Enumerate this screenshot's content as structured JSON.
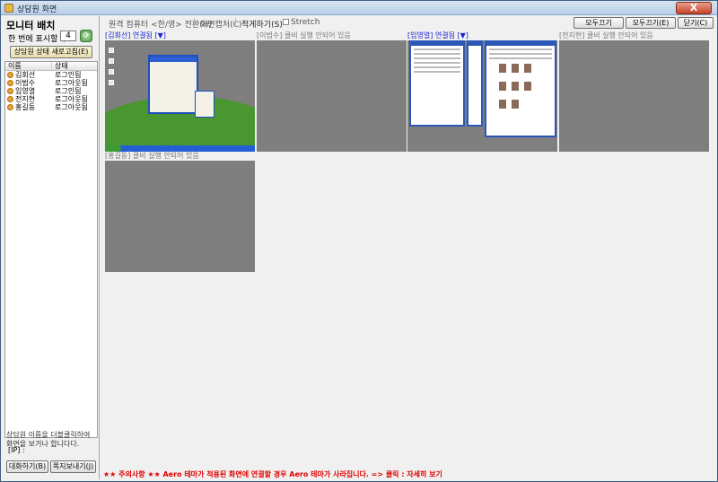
{
  "window": {
    "title": "상담원 화면",
    "close_label": "X"
  },
  "left": {
    "heading": "모니터 배치",
    "count_label": "한 번에 표시할 수",
    "count_value": "4",
    "status_refresh_label": "상담원 상태 새로고침(E)",
    "list_headers": [
      "이름",
      "상태"
    ],
    "agents": [
      {
        "name": "김회선",
        "status": "로그인됨"
      },
      {
        "name": "이범수",
        "status": "로그아웃됨"
      },
      {
        "name": "임영열",
        "status": "로그인됨"
      },
      {
        "name": "전지현",
        "status": "로그아웃됨"
      },
      {
        "name": "홍길동",
        "status": "로그아웃됨"
      }
    ],
    "info_text": "상담원 이름을 더블클릭하여 화면을 보거나 합니다다.",
    "ip_label": "[IP] :",
    "chat_button": "대화하기(B)",
    "message_button": "쪽지보내기(J)"
  },
  "toolbar": {
    "remote_control": "원격 컴퓨터 <한/영> 전환(H)",
    "capture": "화면캡처(C)",
    "arrange": "적게하기(S)",
    "stretch": "Stretch",
    "close_all": "모두끄기",
    "close_all_e": "모두끄기(E)",
    "close": "닫기(C)"
  },
  "tiles": [
    {
      "caption": "[김회선] 연결됨 [▼]",
      "connected": true,
      "kind": "xp"
    },
    {
      "caption": "[이범수] 클비 실행 안되어 있음",
      "connected": false,
      "kind": "empty"
    },
    {
      "caption": "[임영열] 연결됨 [▼]",
      "connected": true,
      "kind": "browser"
    },
    {
      "caption": "[전지현] 클비 실행 안되어 있음",
      "connected": false,
      "kind": "empty"
    },
    {
      "caption": "[홍길동] 클비 실행 안되어 있음",
      "connected": false,
      "kind": "empty"
    }
  ],
  "notice": "★★ 주의사항 ★★ Aero 테마가 적용된 화면에 연결할 경우 Aero 테마가 사라집니다. => 클릭 : 자세히 보기",
  "colors": {
    "connected": "#1a24d0",
    "notice": "#e00000",
    "empty_screen": "#7f7f7f"
  }
}
